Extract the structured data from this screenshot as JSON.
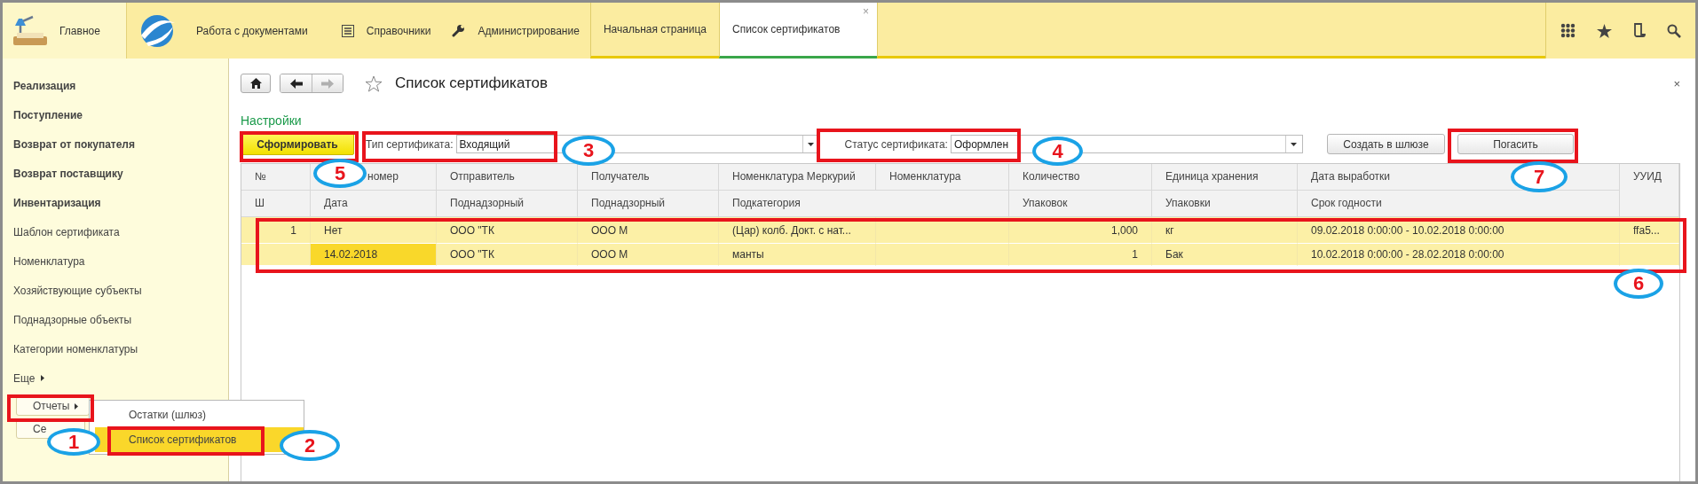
{
  "sections": [
    {
      "label": "Главное",
      "kind": "home"
    },
    {
      "label": "Работа с документами",
      "kind": "documents"
    },
    {
      "label": "Справочники",
      "kind": "catalogs"
    },
    {
      "label": "Администрирование",
      "kind": "admin"
    }
  ],
  "open_tabs": [
    {
      "label": "Начальная страница",
      "selected": false
    },
    {
      "label": "Список сертификатов",
      "selected": true,
      "close_glyph": "×"
    }
  ],
  "sidebar": {
    "items": [
      {
        "label": "Реализация",
        "kind": "bold"
      },
      {
        "label": "Поступление",
        "kind": "bold"
      },
      {
        "label": "Возврат от покупателя",
        "kind": "bold"
      },
      {
        "label": "Возврат поставщику",
        "kind": "bold"
      },
      {
        "label": "Инвентаризация",
        "kind": "bold"
      },
      {
        "label": "Шаблон сертификата",
        "kind": "plain"
      },
      {
        "label": "Номенклатура",
        "kind": "plain"
      },
      {
        "label": "Хозяйствующие субъекты",
        "kind": "plain"
      },
      {
        "label": "Поднадзорные объекты",
        "kind": "plain"
      },
      {
        "label": "Категории номенклатуры",
        "kind": "plain"
      },
      {
        "label": "Еще",
        "kind": "submenu"
      }
    ],
    "buttons": [
      {
        "label": "Отчеты",
        "kind": "submenu"
      },
      {
        "label": "Се",
        "kind": "plain"
      }
    ]
  },
  "popup_menu": [
    {
      "label": "Остатки (шлюз)",
      "selected": false
    },
    {
      "label": "Список сертификатов",
      "selected": true
    }
  ],
  "form": {
    "title": "Список сертификатов",
    "close_glyph": "×",
    "settings_link": "Настройки",
    "generate_button": "Сформировать",
    "type_filter": {
      "label": "Тип сертификата:",
      "value": "Входящий"
    },
    "status_filter": {
      "label": "Статус сертификата:",
      "value": "Оформлен"
    },
    "buttons": [
      "Создать в шлюзе",
      "Погасить"
    ]
  },
  "table": {
    "columns": [
      {
        "header": "№",
        "subheader": "Ш"
      },
      {
        "header": "номер",
        "subheader": "Дата"
      },
      {
        "header": "Отправитель",
        "subheader": "Поднадзорный"
      },
      {
        "header": "Получатель",
        "subheader": "Поднадзорный"
      },
      {
        "header": "Номенклатура Меркурий",
        "subheader": "Подкатегория"
      },
      {
        "header": "Номенклатура"
      },
      {
        "header": "Количество",
        "subheader": "Упаковок"
      },
      {
        "header": "Единица хранения",
        "subheader": "Упаковки"
      },
      {
        "header": "Дата выработки",
        "subheader": "Срок годности"
      },
      {
        "header": "УУИД"
      }
    ],
    "records": [
      {
        "selected": true,
        "lines": [
          [
            {
              "text": "1",
              "selected": false,
              "numeric": true
            },
            {
              "text": "Нет",
              "selected": false
            },
            {
              "text": "ООО \"ТК",
              "selected": false
            },
            {
              "text": "ООО М",
              "selected": false
            },
            {
              "text": "(Цар) колб. Докт. с нат...",
              "selected": false
            },
            {
              "selected": false
            },
            {
              "text": "1,000",
              "selected": false,
              "numeric": true
            },
            {
              "text": "кг",
              "selected": false
            },
            {
              "text": "09.02.2018 0:00:00 - 10.02.2018 0:00:00",
              "selected": false
            },
            {
              "text": "ffa5...",
              "selected": false
            }
          ],
          [
            {
              "selected": false
            },
            {
              "text": "14.02.2018",
              "selected": true
            },
            {
              "text": "ООО \"ТК",
              "selected": false
            },
            {
              "text": "ООО М",
              "selected": false
            },
            {
              "text": "манты",
              "selected": false
            },
            {
              "selected": false
            },
            {
              "text": "1",
              "selected": false,
              "numeric": true
            },
            {
              "text": "Бак",
              "selected": false
            },
            {
              "text": "10.02.2018 0:00:00 - 28.02.2018 0:00:00",
              "selected": false
            },
            {
              "selected": false
            }
          ]
        ]
      }
    ]
  },
  "callouts": [
    {
      "label": "1"
    },
    {
      "label": "2"
    },
    {
      "label": "3"
    },
    {
      "label": "4"
    },
    {
      "label": "5"
    },
    {
      "label": "6"
    },
    {
      "label": "7"
    }
  ]
}
